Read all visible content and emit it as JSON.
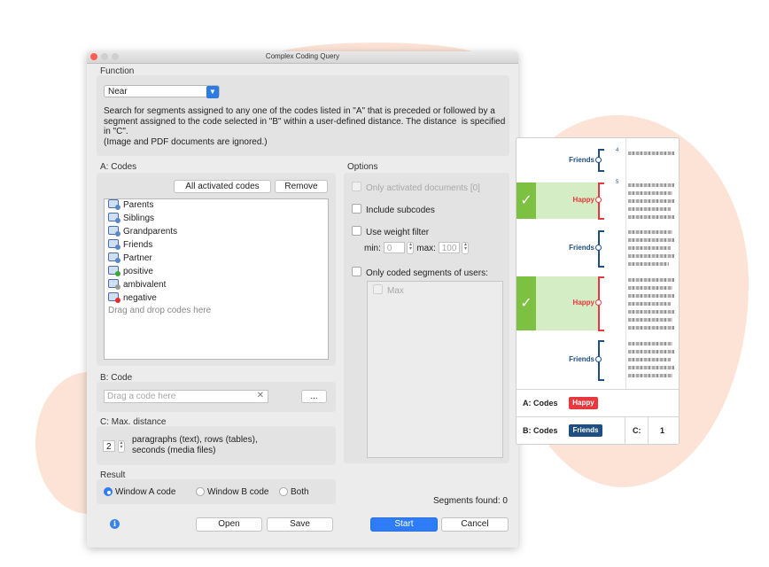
{
  "window": {
    "title": "Complex Coding Query"
  },
  "function": {
    "section_label": "Function",
    "selected": "Near",
    "description": "Search for segments assigned to any one of the codes listed in \"A\" that is preceded or followed by a segment assigned to the code selected in \"B\" within a user-defined distance. The distance  is specified in \"C\".\n(Image and PDF documents are ignored.)"
  },
  "a_codes": {
    "section_label": "A: Codes",
    "all_activated_label": "All activated codes",
    "remove_label": "Remove",
    "items": [
      {
        "label": "Parents",
        "color": "#5b87c5"
      },
      {
        "label": "Siblings",
        "color": "#5b87c5"
      },
      {
        "label": "Grandparents",
        "color": "#5b87c5"
      },
      {
        "label": "Friends",
        "color": "#5b87c5"
      },
      {
        "label": "Partner",
        "color": "#5b87c5"
      },
      {
        "label": "positive",
        "color": "#3aa63a"
      },
      {
        "label": "ambivalent",
        "color": "#9a9a9a"
      },
      {
        "label": "negative",
        "color": "#e52b2b"
      }
    ],
    "drop_hint": "Drag and drop codes here"
  },
  "options": {
    "section_label": "Options",
    "only_activated": "Only activated documents [0]",
    "include_subcodes": "Include subcodes",
    "use_weight_filter": "Use weight filter",
    "min_label": "min:",
    "min_value": "0",
    "max_label": "max:",
    "max_value": "100",
    "only_coded_users": "Only coded segments of users:",
    "users": [
      "Max"
    ]
  },
  "b_code": {
    "section_label": "B: Code",
    "placeholder": "Drag a code here",
    "clear_glyph": "✕",
    "browse_label": "..."
  },
  "c_distance": {
    "section_label": "C: Max. distance",
    "value": "2",
    "unit_text": "paragraphs (text), rows (tables),\nseconds (media files)"
  },
  "result": {
    "section_label": "Result",
    "options": [
      "Window A code",
      "Window B code",
      "Both"
    ],
    "selected_index": 0
  },
  "status": {
    "segments_found": "Segments found: 0"
  },
  "buttons": {
    "open": "Open",
    "save": "Save",
    "start": "Start",
    "cancel": "Cancel"
  },
  "illustration": {
    "line_numbers": [
      "4",
      "5"
    ],
    "codes": [
      {
        "label": "Friends",
        "color": "#1f4e82"
      },
      {
        "label": "Happy",
        "color": "#e8383d"
      },
      {
        "label": "Friends",
        "color": "#1f4e82"
      },
      {
        "label": "Happy",
        "color": "#e8383d"
      },
      {
        "label": "Friends",
        "color": "#1f4e82"
      }
    ],
    "check_glyph": "✓",
    "legend": {
      "a_label": "A: Codes",
      "a_chip": "Happy",
      "b_label": "B: Codes",
      "b_chip": "Friends",
      "c_label": "C:",
      "c_value": "1"
    }
  }
}
